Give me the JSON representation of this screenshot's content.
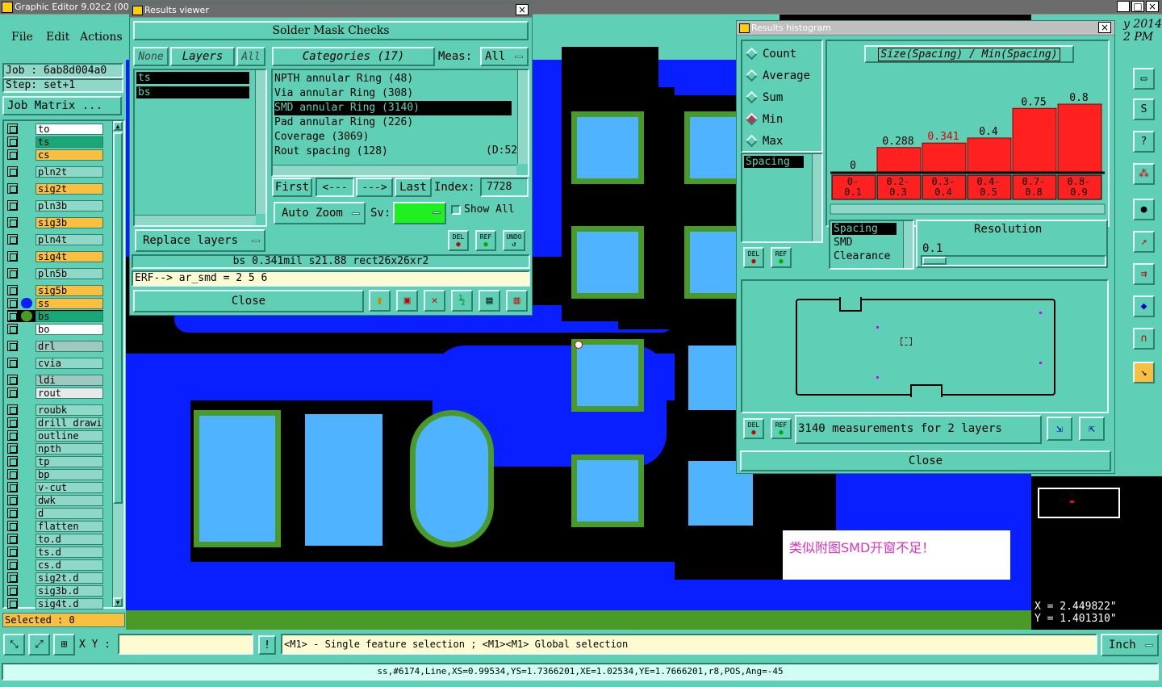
{
  "main_window": {
    "title": "Graphic Editor 9.02c2 (00",
    "date_fragment": "y 2014",
    "time_fragment": "2 PM"
  },
  "menu": {
    "file": "File",
    "edit": "Edit",
    "actions": "Actions"
  },
  "job": {
    "job_label": "Job : 6ab8d004a0",
    "step_label": "Step: set+1",
    "matrix_button": "Job Matrix ..."
  },
  "layers": [
    {
      "name": "to",
      "color": "#ffffff"
    },
    {
      "name": "ts",
      "color": "#18a878"
    },
    {
      "name": "cs",
      "color": "#f8bf40"
    },
    {
      "name": "pln2t",
      "color": "#8fd8c8"
    },
    {
      "name": "sig2t",
      "color": "#f8bf40"
    },
    {
      "name": "pln3b",
      "color": "#8fd8c8"
    },
    {
      "name": "sig3b",
      "color": "#f8bf40"
    },
    {
      "name": "pln4t",
      "color": "#8fd8c8"
    },
    {
      "name": "sig4t",
      "color": "#f8bf40"
    },
    {
      "name": "pln5b",
      "color": "#8fd8c8"
    },
    {
      "name": "sig5b",
      "color": "#f8bf40"
    },
    {
      "name": "ss",
      "color": "#f8bf40"
    },
    {
      "name": "bs",
      "color": "#18a878"
    },
    {
      "name": "bo",
      "color": "#ffffff"
    },
    {
      "name": "drl",
      "color": "#9fc8c0"
    },
    {
      "name": "cvia",
      "color": "#8fd8c8"
    },
    {
      "name": "ldi",
      "color": "#9fc8c0"
    },
    {
      "name": "rout",
      "color": "#e8e8e8"
    },
    {
      "name": "roubk",
      "color": "#8fd8c8"
    },
    {
      "name": "drill_drawi",
      "color": "#8fd8c8"
    },
    {
      "name": "outline",
      "color": "#8fd8c8"
    },
    {
      "name": "npth",
      "color": "#8fd8c8"
    },
    {
      "name": "tp",
      "color": "#8fd8c8"
    },
    {
      "name": "bp",
      "color": "#8fd8c8"
    },
    {
      "name": "v-cut",
      "color": "#8fd8c8"
    },
    {
      "name": "dwk",
      "color": "#8fd8c8"
    },
    {
      "name": "d",
      "color": "#8fd8c8"
    },
    {
      "name": "flatten",
      "color": "#8fd8c8"
    },
    {
      "name": "to.d",
      "color": "#8fd8c8"
    },
    {
      "name": "ts.d",
      "color": "#8fd8c8"
    },
    {
      "name": "cs.d",
      "color": "#8fd8c8"
    },
    {
      "name": "sig2t.d",
      "color": "#8fd8c8"
    },
    {
      "name": "sig3b.d",
      "color": "#8fd8c8"
    },
    {
      "name": "sig4t.d",
      "color": "#8fd8c8"
    }
  ],
  "selected_label": "Selected : 0",
  "results_viewer": {
    "title": "Results viewer",
    "header": "Solder Mask Checks",
    "none_btn": "None",
    "layers_btn": "Layers",
    "all_btn": "All",
    "layer_items": [
      "ts",
      "bs"
    ],
    "categories_btn": "Categories (17)",
    "meas_label": "Meas:",
    "meas_value": "All",
    "categories": [
      "NPTH annular Ring (48)",
      "Via annular Ring (308)",
      "SMD annular Ring (3140)",
      "Pad annular Ring (226)",
      "Coverage (3069)",
      "Rout spacing (128)"
    ],
    "rout_extra": "(D:52)",
    "first_btn": "First",
    "prev_btn": "<---",
    "next_btn": "--->",
    "last_btn": "Last",
    "index_label": "Index:",
    "index_value": "7728",
    "autozoom_btn": "Auto Zoom",
    "sv_label": "Sv:",
    "show_all": "Show All",
    "replace_btn": "Replace layers",
    "del": "DEL",
    "ref": "REF",
    "undo": "UNDO",
    "info_line": "bs 0.341mil   s21.88   rect26x26xr2",
    "erf_line": "ERF--> ar_smd = 2 5 6",
    "close": "Close"
  },
  "histogram": {
    "title": "Results histogram",
    "modes": [
      "Count",
      "Average",
      "Sum",
      "Min",
      "Max"
    ],
    "selected_mode": "Min",
    "chart_title": "Size(Spacing) / Min(Spacing)",
    "list_items": [
      "Spacing"
    ],
    "bar_values": [
      "0",
      "0.288",
      "0.341",
      "0.4",
      "0.75",
      "0.8"
    ],
    "bins": [
      "0-\n0.1",
      "0.2-\n0.3",
      "0.3-\n0.4",
      "0.4-\n0.5",
      "0.7-\n0.8",
      "0.8-\n0.9"
    ],
    "type_items": [
      "Spacing",
      "SMD",
      "Clearance"
    ],
    "resolution_label": "Resolution",
    "resolution_value": "0.1",
    "status": "3140 measurements for 2 layers",
    "close": "Close",
    "del": "DEL",
    "ref": "REF"
  },
  "chart_data": {
    "type": "bar",
    "title": "Size(Spacing) / Min(Spacing)",
    "categories": [
      "0-0.1",
      "0.2-0.3",
      "0.3-0.4",
      "0.4-0.5",
      "0.7-0.8",
      "0.8-0.9"
    ],
    "values": [
      0,
      0.288,
      0.341,
      0.4,
      0.75,
      0.8
    ],
    "highlight": "0.3-0.4"
  },
  "annotation": "类似附图SMD开窗不足！",
  "coords": {
    "x": "X = 2.449822\"",
    "y": "Y = 1.401310\""
  },
  "bottom": {
    "xy_label": "X Y :",
    "hint": "<M1> - Single feature selection ; <M1><M1> Global selection",
    "units": "Inch",
    "status": "ss,#6174,Line,XS=0.99534,YS=1.7366201,XE=1.02534,YE=1.7666201,r8,POS,Ang=-45",
    "excl": "!"
  },
  "colors": {
    "panel": "#5fcfb5",
    "canvas_blue": "#0a1fff",
    "pad_blue": "#4fb3ff",
    "copper_green": "#4a9a28",
    "bar_red": "#ff2020"
  }
}
